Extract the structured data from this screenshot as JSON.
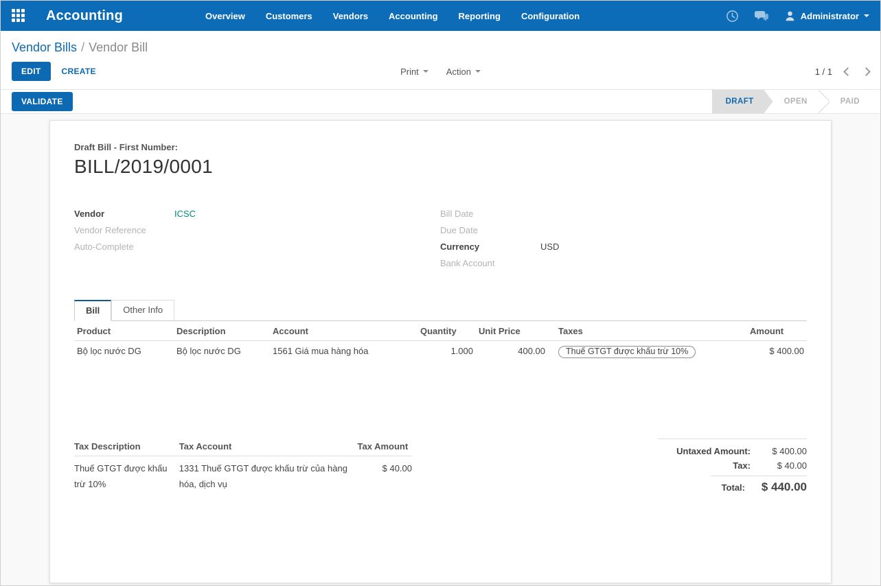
{
  "colors": {
    "navbar": "#0c6cb8",
    "primary": "#0d6ab2",
    "link_teal": "#008784",
    "state_bg": "#dedede"
  },
  "navbar": {
    "brand": "Accounting",
    "items": [
      "Overview",
      "Customers",
      "Vendors",
      "Accounting",
      "Reporting",
      "Configuration"
    ],
    "user": "Administrator"
  },
  "control_panel": {
    "breadcrumb": {
      "parent": "Vendor Bills",
      "separator": "/",
      "current": "Vendor Bill"
    },
    "edit_label": "EDIT",
    "create_label": "CREATE",
    "print_label": "Print",
    "action_label": "Action",
    "pager": "1 / 1"
  },
  "statusbar": {
    "validate_label": "VALIDATE",
    "states": [
      {
        "label": "DRAFT",
        "active": true
      },
      {
        "label": "OPEN",
        "active": false
      },
      {
        "label": "PAID",
        "active": false
      }
    ]
  },
  "sheet": {
    "subtitle": "Draft Bill - First Number:",
    "title": "BILL/2019/0001",
    "fields_left": [
      {
        "label": "Vendor",
        "value": "ICSC"
      },
      {
        "label": "Vendor Reference",
        "value": ""
      },
      {
        "label": "Auto-Complete",
        "value": ""
      }
    ],
    "fields_right": [
      {
        "label": "Bill Date",
        "value": ""
      },
      {
        "label": "Due Date",
        "value": ""
      },
      {
        "label": "Currency",
        "value": "USD"
      },
      {
        "label": "Bank Account",
        "value": ""
      }
    ],
    "tabs": [
      {
        "label": "Bill",
        "active": true
      },
      {
        "label": "Other Info",
        "active": false
      }
    ],
    "lines_table": {
      "headers": [
        "Product",
        "Description",
        "Account",
        "Quantity",
        "Unit Price",
        "Taxes",
        "Amount"
      ],
      "rows": [
        {
          "product": "Bộ lọc nước DG",
          "description": "Bộ lọc nước DG",
          "account": "1561 Giá mua hàng hóa",
          "quantity": "1.000",
          "unit_price": "400.00",
          "taxes": "Thuế GTGT được khấu trừ 10%",
          "amount": "$ 400.00"
        }
      ]
    },
    "tax_table": {
      "headers": [
        "Tax Description",
        "Tax Account",
        "Tax Amount"
      ],
      "rows": [
        {
          "description": "Thuế GTGT được khấu trừ 10%",
          "account": "1331 Thuế GTGT được khấu trừ của hàng hóa, dịch vụ",
          "amount": "$ 40.00"
        }
      ]
    },
    "totals": {
      "untaxed_label": "Untaxed Amount:",
      "untaxed_value": "$ 400.00",
      "tax_label": "Tax:",
      "tax_value": "$ 40.00",
      "total_label": "Total:",
      "total_value": "$ 440.00"
    }
  }
}
